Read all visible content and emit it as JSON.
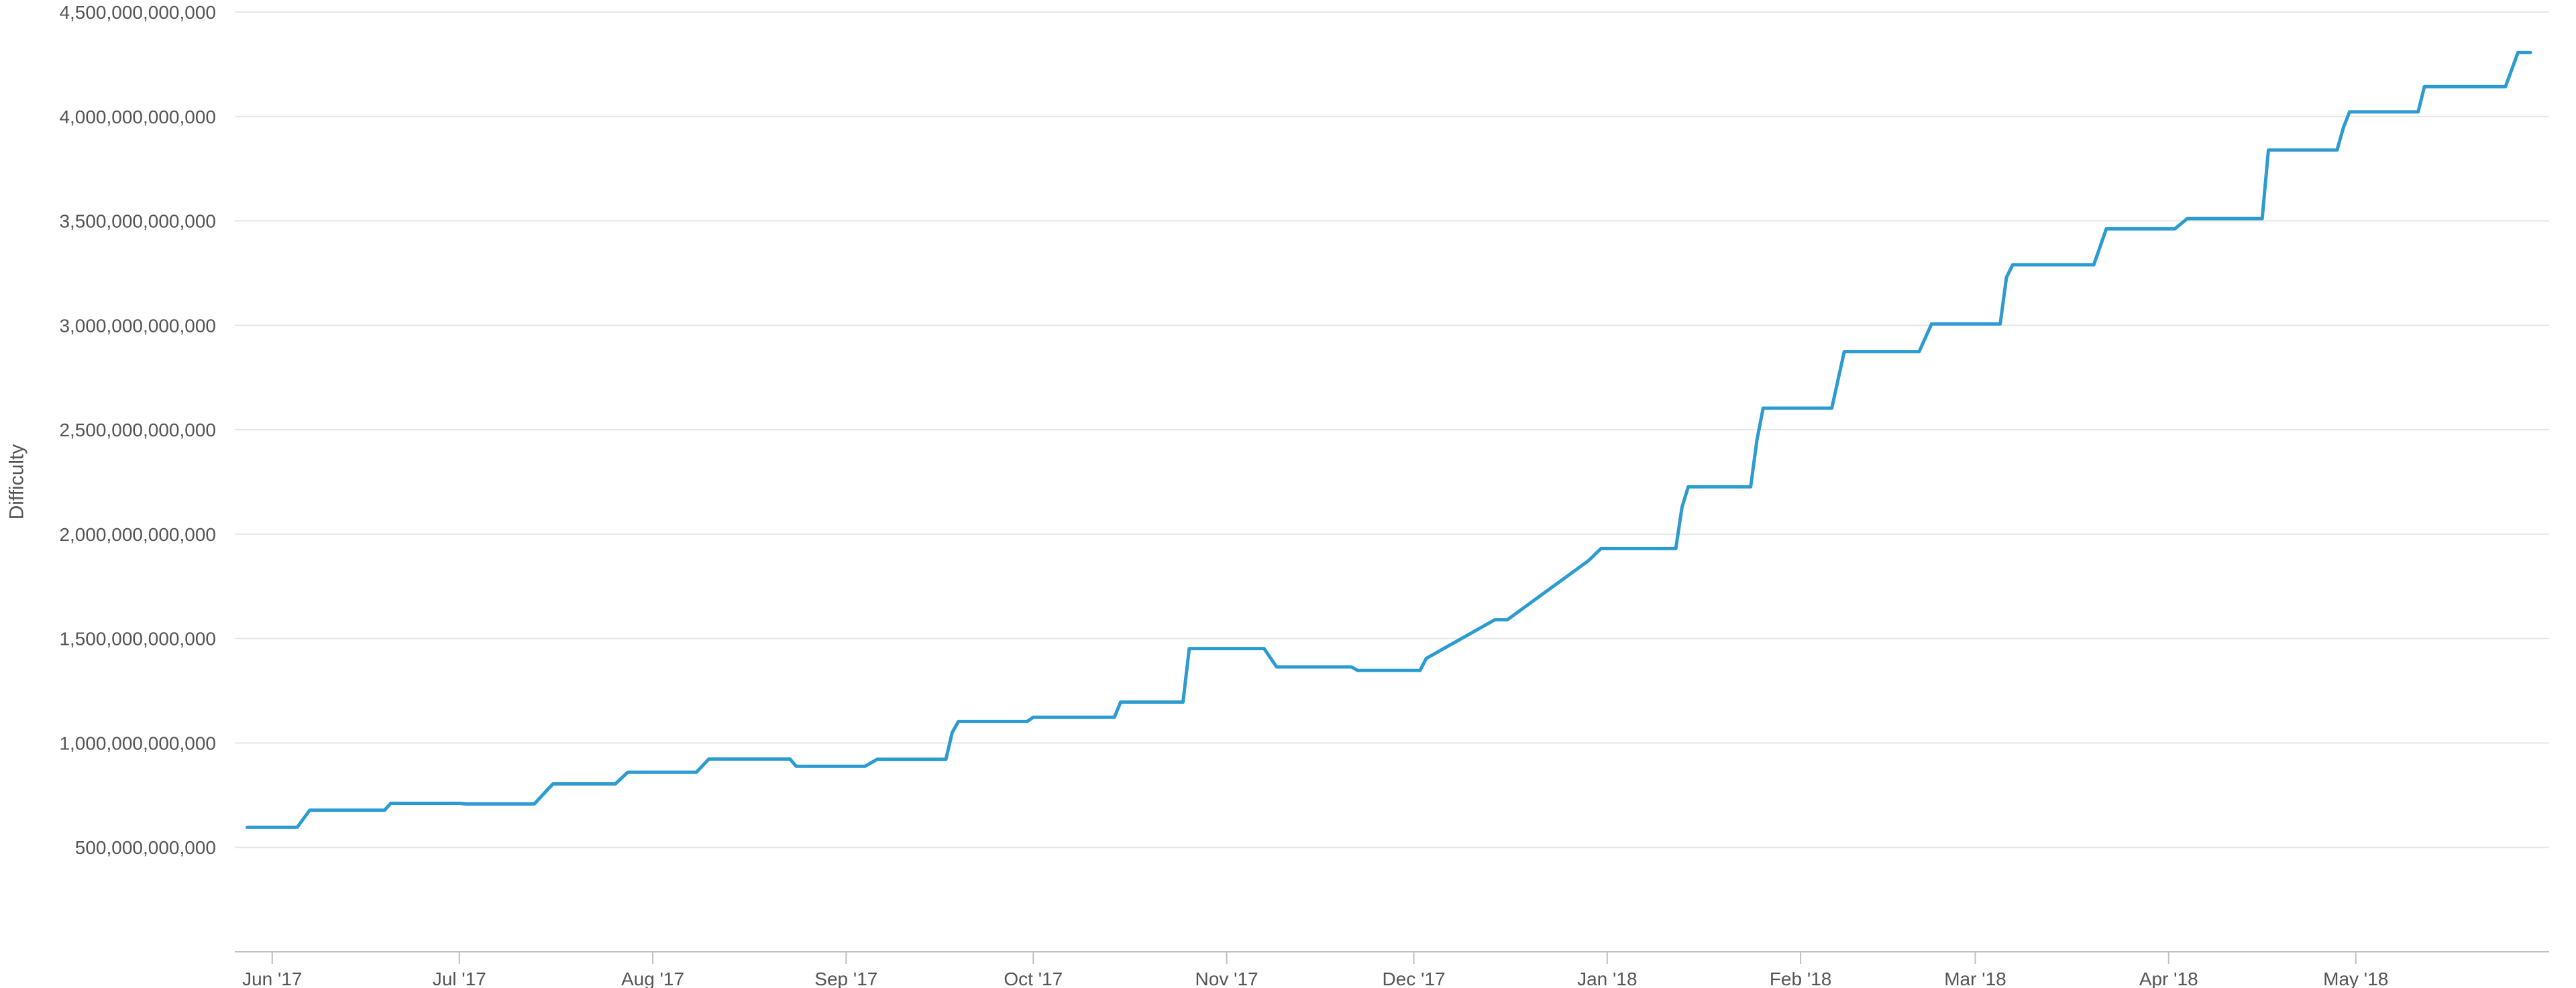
{
  "chart_data": {
    "type": "line",
    "title": "",
    "xlabel": "",
    "ylabel": "Difficulty",
    "ylim": [
      0,
      4500000000000
    ],
    "xlim": [
      "2017-05-26",
      "2018-06-01"
    ],
    "grid": true,
    "legend": "none",
    "line_color": "#2B9BD1",
    "grid_color": "#E6E6E6",
    "axis_color": "#C0C0C0",
    "y_ticks": [
      500000000000,
      1000000000000,
      1500000000000,
      2000000000000,
      2500000000000,
      3000000000000,
      3500000000000,
      4000000000000,
      4500000000000
    ],
    "y_tick_labels": [
      "500,000,000,000",
      "1,000,000,000,000",
      "1,500,000,000,000",
      "2,000,000,000,000",
      "2,500,000,000,000",
      "3,000,000,000,000",
      "3,500,000,000,000",
      "4,000,000,000,000",
      "4,500,000,000,000"
    ],
    "x_ticks": [
      "2017-06-01",
      "2017-07-01",
      "2017-08-01",
      "2017-09-01",
      "2017-10-01",
      "2017-11-01",
      "2017-12-01",
      "2018-01-01",
      "2018-02-01",
      "2018-03-01",
      "2018-04-01",
      "2018-05-01"
    ],
    "x_tick_labels": [
      "Jun '17",
      "Jul '17",
      "Aug '17",
      "Sep '17",
      "Oct '17",
      "Nov '17",
      "Dec '17",
      "Jan '18",
      "Feb '18",
      "Mar '18",
      "Apr '18",
      "May '18"
    ],
    "series": [
      {
        "x": [
          "2017-05-28",
          "2017-06-05",
          "2017-06-07",
          "2017-06-19",
          "2017-06-20",
          "2017-07-01",
          "2017-07-02",
          "2017-07-13",
          "2017-07-16",
          "2017-07-26",
          "2017-07-28",
          "2017-08-08",
          "2017-08-10",
          "2017-08-23",
          "2017-08-24",
          "2017-09-04",
          "2017-09-06",
          "2017-09-17",
          "2017-09-18",
          "2017-09-19",
          "2017-09-30",
          "2017-10-01",
          "2017-10-14",
          "2017-10-15",
          "2017-10-25",
          "2017-10-26",
          "2017-11-07",
          "2017-11-09",
          "2017-11-21",
          "2017-11-22",
          "2017-12-02",
          "2017-12-03",
          "2017-12-14",
          "2017-12-15",
          "2017-12-16",
          "2017-12-29",
          "2017-12-31",
          "2018-01-12",
          "2018-01-13",
          "2018-01-14",
          "2018-01-24",
          "2018-01-25",
          "2018-01-26",
          "2018-02-06",
          "2018-02-08",
          "2018-02-20",
          "2018-02-22",
          "2018-03-05",
          "2018-03-06",
          "2018-03-07",
          "2018-03-20",
          "2018-03-22",
          "2018-04-02",
          "2018-04-04",
          "2018-04-16",
          "2018-04-17",
          "2018-04-28",
          "2018-04-29",
          "2018-04-30",
          "2018-05-11",
          "2018-05-12",
          "2018-05-25",
          "2018-05-27",
          "2018-05-29"
        ],
        "values": [
          596000000000,
          596000000000,
          678000000000,
          678000000000,
          711000000000,
          711000000000,
          708000000000,
          708000000000,
          804000000000,
          804000000000,
          860000000000,
          860000000000,
          923000000000,
          923000000000,
          888000000000,
          888000000000,
          922000000000,
          922000000000,
          1050000000000,
          1103000000000,
          1103000000000,
          1123000000000,
          1123000000000,
          1196000000000,
          1196000000000,
          1452000000000,
          1452000000000,
          1364000000000,
          1364000000000,
          1347000000000,
          1347000000000,
          1405000000000,
          1590000000000,
          1590000000000,
          1590000000000,
          1873000000000,
          1931000000000,
          1931000000000,
          2130000000000,
          2227000000000,
          2227000000000,
          2450000000000,
          2603000000000,
          2603000000000,
          2874000000000,
          2874000000000,
          3007000000000,
          3007000000000,
          3230000000000,
          3290000000000,
          3290000000000,
          3462000000000,
          3462000000000,
          3511000000000,
          3511000000000,
          3839000000000,
          3839000000000,
          3945000000000,
          4022000000000,
          4022000000000,
          4143000000000,
          4143000000000,
          4306000000000,
          4306000000000
        ]
      }
    ]
  }
}
